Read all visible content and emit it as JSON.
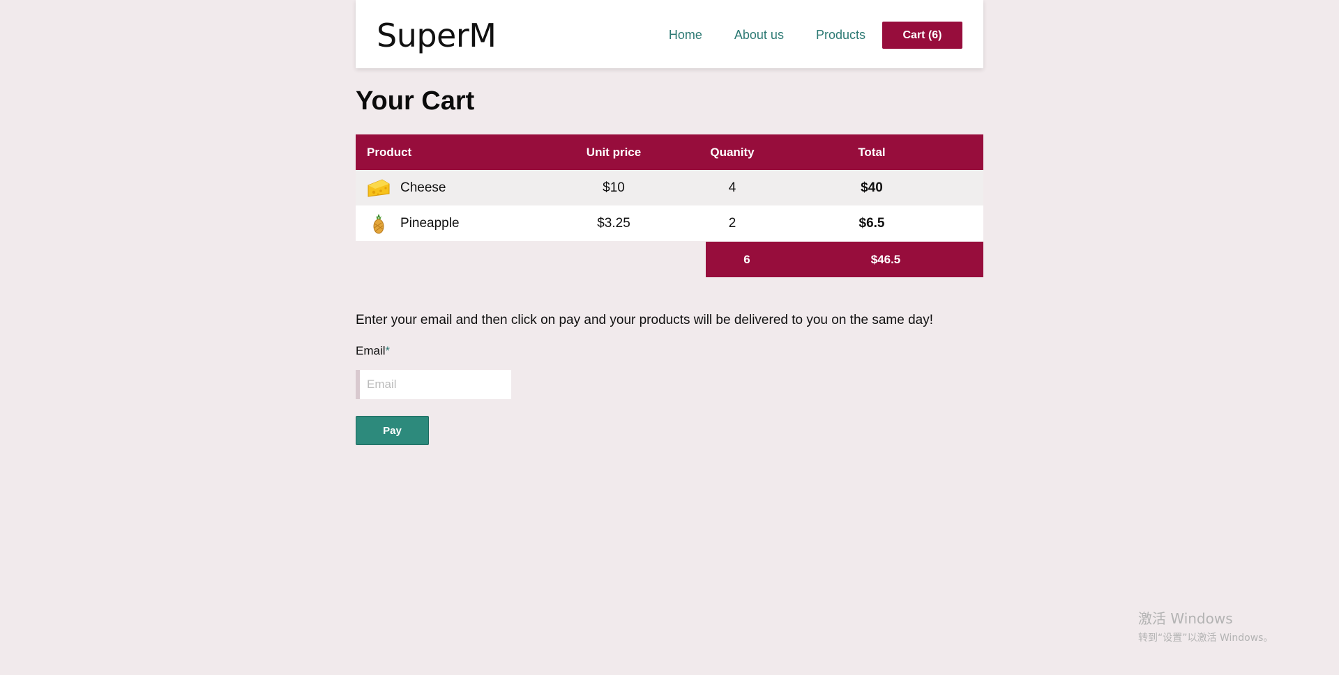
{
  "header": {
    "logo": "SuperM",
    "nav": [
      "Home",
      "About us",
      "Products"
    ],
    "cart_label": "Cart (6)"
  },
  "title": "Your Cart",
  "table": {
    "headers": {
      "product": "Product",
      "unit_price": "Unit price",
      "quantity": "Quanity",
      "total": "Total"
    },
    "rows": [
      {
        "icon": "cheese-icon",
        "name": "Cheese",
        "unit_price": "$10",
        "quantity": "4",
        "total": "$40"
      },
      {
        "icon": "pineapple-icon",
        "name": "Pineapple",
        "unit_price": "$3.25",
        "quantity": "2",
        "total": "$6.5"
      }
    ],
    "summary": {
      "quantity": "6",
      "total": "$46.5"
    }
  },
  "checkout": {
    "info": "Enter your email and then click on pay and your products will be delivered to you on the same day!",
    "email_label": "Email",
    "required_mark": "*",
    "email_placeholder": "Email",
    "pay_label": "Pay"
  },
  "watermark": {
    "title": "激活 Windows",
    "subtitle": "转到“设置”以激活 Windows。"
  },
  "colors": {
    "accent": "#970d3c",
    "teal": "#2d7a74",
    "pay": "#2d8a7c",
    "background": "#f1eaec"
  }
}
